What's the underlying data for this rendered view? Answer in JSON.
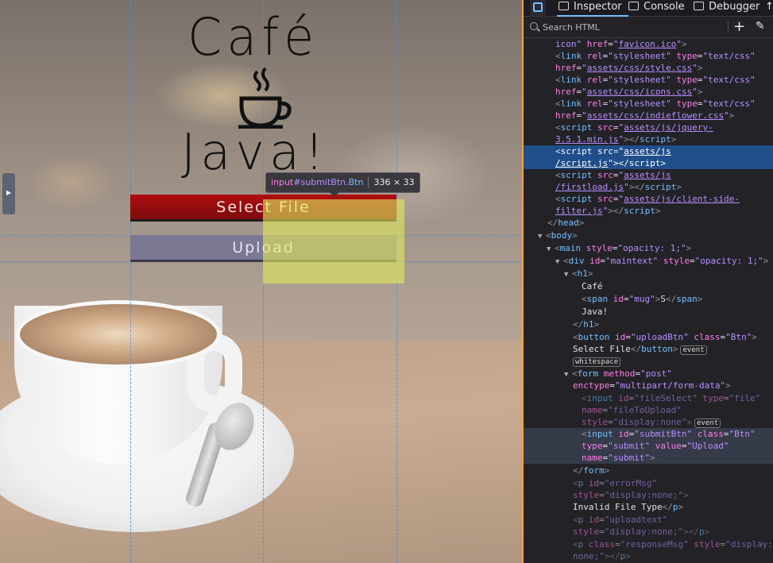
{
  "page": {
    "title_line1": "Café",
    "title_line2": "Java!",
    "mug_icon": "coffee-cup-steam-icon",
    "select_button": "Select File",
    "upload_button": "Upload"
  },
  "tooltip": {
    "tag": "input",
    "id": "#submitBtn",
    "class": ".Btn",
    "size": "336 × 33"
  },
  "devtools": {
    "tabs": {
      "inspector": "Inspector",
      "console": "Console",
      "debugger": "Debugger"
    },
    "search_placeholder": "Search HTML",
    "colors": {
      "accent": "#75bfff",
      "selection": "#204e8a",
      "highlight": "#e2e85c"
    }
  }
}
